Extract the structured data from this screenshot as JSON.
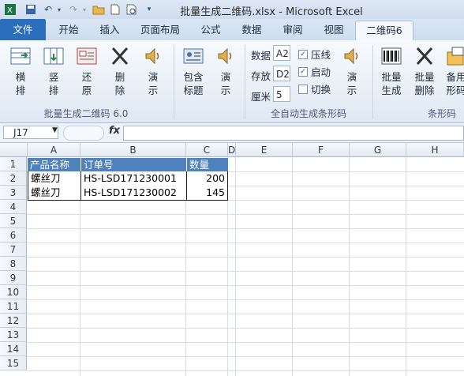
{
  "window": {
    "title": "批量生成二维码.xlsx  -  Microsoft Excel"
  },
  "quick_access": {
    "icons": [
      "excel-logo-icon",
      "save-icon",
      "undo-icon",
      "redo-icon",
      "open-folder-icon",
      "new-file-icon",
      "print-preview-icon"
    ]
  },
  "tabs": [
    {
      "label": "文件"
    },
    {
      "label": "开始"
    },
    {
      "label": "插入"
    },
    {
      "label": "页面布局"
    },
    {
      "label": "公式"
    },
    {
      "label": "数据"
    },
    {
      "label": "审阅"
    },
    {
      "label": "视图"
    },
    {
      "label": "二维码6"
    }
  ],
  "ribbon": {
    "group1": {
      "label": "批量生成二维码 6.0",
      "buttons": [
        {
          "label": "横\n排"
        },
        {
          "label": "竖\n排"
        },
        {
          "label": "还\n原"
        },
        {
          "label": "删\n除"
        },
        {
          "label": "演\n示"
        }
      ]
    },
    "group2": {
      "label": "全自动生成条形码",
      "buttons": [
        {
          "label": "包含\n标题"
        },
        {
          "label": "演\n示"
        }
      ],
      "fields": [
        {
          "label": "数据",
          "value": "A2"
        },
        {
          "label": "存放",
          "value": "D2"
        },
        {
          "label": "厘米",
          "value": "5"
        }
      ],
      "checkboxes": [
        {
          "label": "压线",
          "checked": "✓"
        },
        {
          "label": "启动",
          "checked": "✓"
        },
        {
          "label": "切换",
          "checked": ""
        }
      ],
      "demo": {
        "label": "演\n示"
      }
    },
    "group3": {
      "label": "条形码",
      "buttons": [
        {
          "label": "批量\n生成"
        },
        {
          "label": "批量\n删除"
        },
        {
          "label": "备用\n形码"
        }
      ]
    }
  },
  "formula_bar": {
    "name_box": "J17",
    "fx": "fx",
    "formula": ""
  },
  "sheet": {
    "columns": [
      "A",
      "B",
      "C",
      "D",
      "E",
      "F",
      "G",
      "H"
    ],
    "rows": [
      "1",
      "2",
      "3",
      "4",
      "5",
      "6",
      "7",
      "8",
      "9",
      "10",
      "11",
      "12",
      "13",
      "14",
      "15"
    ],
    "header": [
      "产品名称",
      "订单号",
      "数量"
    ],
    "data": [
      [
        "螺丝刀",
        "HS-LSD171230001",
        "200"
      ],
      [
        "螺丝刀",
        "HS-LSD171230002",
        "145"
      ]
    ]
  },
  "colors": {
    "file_tab": "#2a6ebc",
    "header_fill": "#4f81bd",
    "ribbon_bg": "#eaf0f8"
  }
}
